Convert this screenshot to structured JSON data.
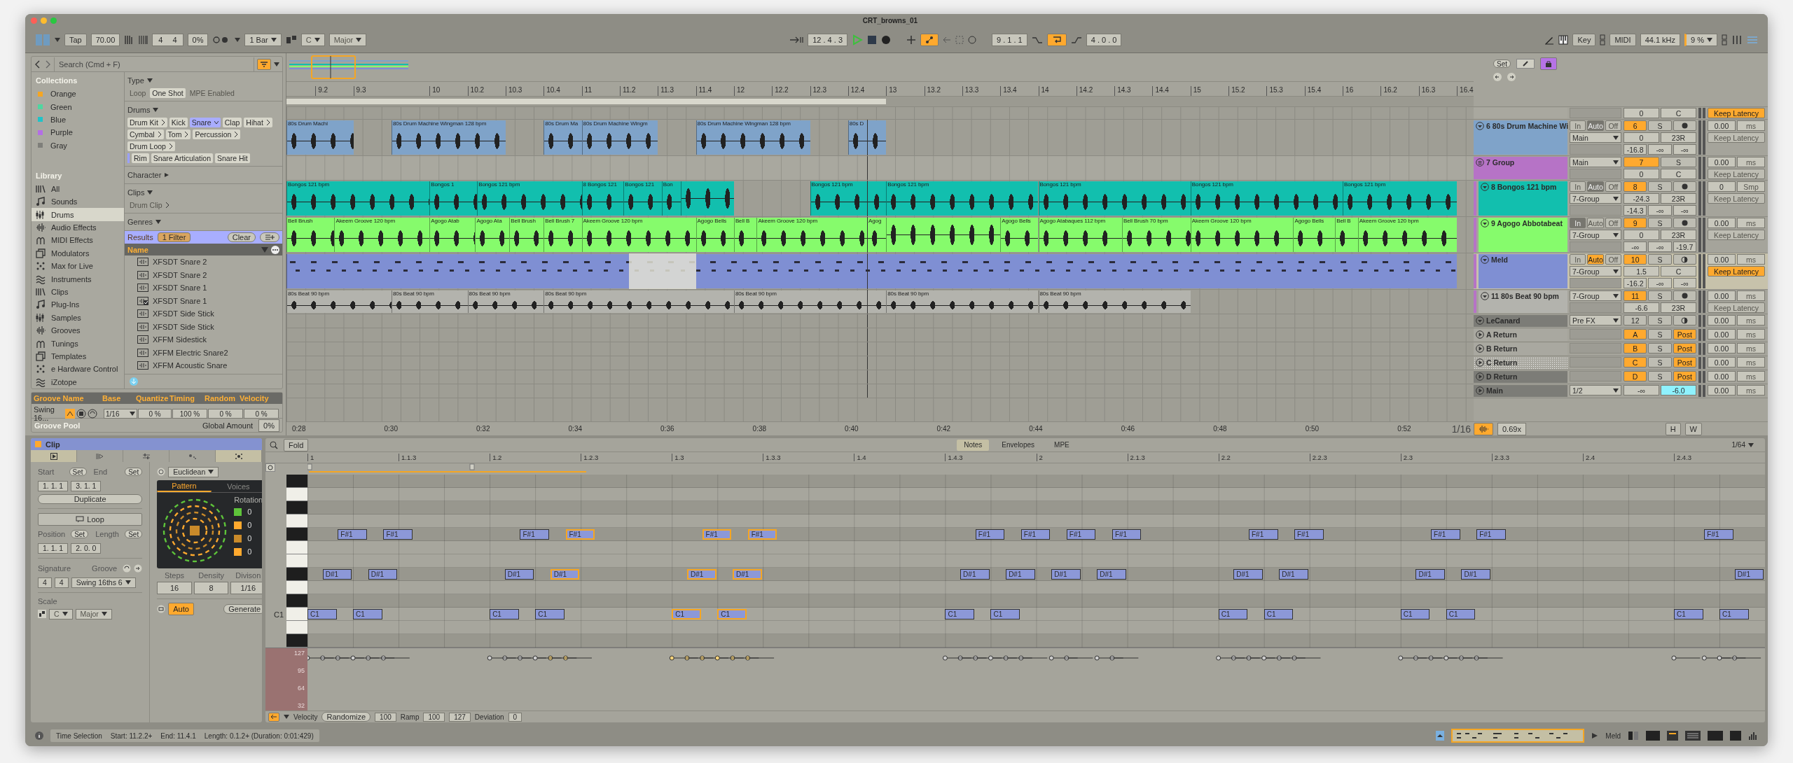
{
  "window": {
    "title": "CRT_browns_01"
  },
  "toolbar": {
    "tap": "Tap",
    "tempo": "70.00",
    "signature": [
      "4",
      "4"
    ],
    "groove_amount": "0%",
    "quantize": "1 Bar",
    "key": "C",
    "scale": "Major",
    "position": "12 . 4 . 3",
    "automation_arm": true,
    "loop_start": "9 . 1 . 1",
    "loop_on": true,
    "loop_length": "4 . 0 . 0",
    "key_map": "Key",
    "midi_map": "MIDI",
    "sample_rate": "44.1 kHz",
    "cpu": "9 %"
  },
  "browser": {
    "search": {
      "placeholder": "Search (Cmd + F)"
    },
    "collections": {
      "title": "Collections",
      "items": [
        {
          "label": "Orange",
          "color": "#f5a623"
        },
        {
          "label": "Green",
          "color": "#4fd6a0"
        },
        {
          "label": "Blue",
          "color": "#1fc3c8"
        },
        {
          "label": "Purple",
          "color": "#b46ee6"
        },
        {
          "label": "Gray",
          "color": "#7f7f7a"
        }
      ]
    },
    "library": {
      "title": "Library",
      "items": [
        {
          "label": "All",
          "selected": false
        },
        {
          "label": "Sounds",
          "selected": false
        },
        {
          "label": "Drums",
          "selected": true
        },
        {
          "label": "Audio Effects",
          "selected": false
        },
        {
          "label": "MIDI Effects",
          "selected": false
        },
        {
          "label": "Modulators",
          "selected": false
        },
        {
          "label": "Max for Live",
          "selected": false
        },
        {
          "label": "Instruments",
          "selected": false
        },
        {
          "label": "Clips",
          "selected": false
        },
        {
          "label": "Plug-Ins",
          "selected": false
        },
        {
          "label": "Samples",
          "selected": false
        },
        {
          "label": "Grooves",
          "selected": false
        },
        {
          "label": "Tunings",
          "selected": false
        },
        {
          "label": "Templates",
          "selected": false
        },
        {
          "label": "e Hardware Control",
          "selected": false
        },
        {
          "label": "iZotope",
          "selected": false
        }
      ]
    },
    "filters": [
      {
        "title": "Type",
        "kind": "toggles",
        "expanded": true,
        "chips": [
          {
            "label": "Loop",
            "selected": false
          },
          {
            "label": "One Shot",
            "selected": true
          },
          {
            "label": "MPE Enabled",
            "selected": false
          }
        ]
      },
      {
        "title": "Drums",
        "kind": "tags",
        "expanded": true,
        "chips": [
          {
            "label": "Drum Kit",
            "selected": false,
            "more": true
          },
          {
            "label": "Kick",
            "selected": false,
            "more": false
          },
          {
            "label": "Snare",
            "selected": true,
            "more": true
          },
          {
            "label": "Clap",
            "selected": false,
            "more": false
          },
          {
            "label": "Hihat",
            "selected": false,
            "more": true
          },
          {
            "label": "Cymbal",
            "selected": false,
            "more": true
          },
          {
            "label": "Tom",
            "selected": false,
            "more": true
          },
          {
            "label": "Percussion",
            "selected": false,
            "more": true
          },
          {
            "label": "Drum Loop",
            "selected": false,
            "more": true
          }
        ],
        "subchips": [
          {
            "label": "Rim"
          },
          {
            "label": "Snare Articulation"
          },
          {
            "label": "Snare Hit"
          }
        ]
      },
      {
        "title": "Character",
        "expanded": false
      },
      {
        "title": "Clips",
        "kind": "tags",
        "expanded": true,
        "chips": [
          {
            "label": "Drum Clip",
            "selected": false,
            "more": true,
            "disabled": true
          }
        ]
      },
      {
        "title": "Genres",
        "expanded": true
      }
    ],
    "results": {
      "title": "Results",
      "filter_count": "1 Filter",
      "clear": "Clear",
      "column": "Name",
      "items": [
        {
          "label": "XFSDT Snare 2",
          "kind": "sample"
        },
        {
          "label": "XFSDT Snare 2",
          "kind": "sample"
        },
        {
          "label": "XFSDT Snare 1",
          "kind": "sample"
        },
        {
          "label": "XFSDT Snare 1",
          "kind": "checked"
        },
        {
          "label": "XFSDT Side Stick",
          "kind": "sample"
        },
        {
          "label": "XFSDT Side Stick",
          "kind": "sample"
        },
        {
          "label": "XFFM Sidestick",
          "kind": "sample"
        },
        {
          "label": "XFFM Electric Snare2",
          "kind": "sample"
        },
        {
          "label": "XFFM Acoustic Snare",
          "kind": "sample"
        }
      ]
    }
  },
  "groove": {
    "columns": [
      "Groove Name",
      "Base",
      "Quantize",
      "Timing",
      "Random",
      "Velocity"
    ],
    "row": {
      "name": "Swing 16...",
      "base": "1/16",
      "quantize": "0 %",
      "timing": "100 %",
      "random": "0 %",
      "velocity": "0 %"
    },
    "pool_title": "Groove Pool",
    "global_label": "Global Amount",
    "global_value": "0%"
  },
  "arrangement": {
    "ruler": [
      "9.2",
      "9.3",
      "10",
      "10.2",
      "10.3",
      "10.4",
      "11",
      "11.2",
      "11.3",
      "11.4",
      "12",
      "12.2",
      "12.3",
      "12.4",
      "13",
      "13.2",
      "13.3",
      "13.4",
      "14",
      "14.2",
      "14.3",
      "14.4",
      "15",
      "15.2",
      "15.3",
      "15.4",
      "16",
      "16.2",
      "16.3",
      "16.4"
    ],
    "time_ruler": [
      "0:28",
      "0:30",
      "0:32",
      "0:34",
      "0:36",
      "0:38",
      "0:40",
      "0:42",
      "0:44",
      "0:46",
      "0:48",
      "0:50",
      "0:52"
    ],
    "grid": "1/16",
    "mixer": {
      "set": "Set",
      "lock_on": true,
      "waveform_on": true,
      "zoom": "0.69x",
      "h": "H",
      "w": "W"
    },
    "tracks": [
      {
        "kind": "top",
        "volume": "0",
        "pan": "C",
        "latency": {
          "label": "Keep Latency",
          "on": true
        }
      },
      {
        "kind": "audio",
        "name": "6 80s Drum Machine Wi",
        "color": "#7fa3c9",
        "selected": false,
        "expanded": true,
        "monitor": [
          {
            "label": "In",
            "selected": false
          },
          {
            "label": "Auto",
            "selected": true
          },
          {
            "label": "Off",
            "selected": false
          }
        ],
        "route": "Main",
        "number": "6",
        "number_on": true,
        "solo": "S",
        "third": {
          "kind": "arm"
        },
        "volume": "0",
        "pan": "23R",
        "sends": [
          "-16.8",
          "-∞",
          "-∞"
        ],
        "delay": "0.00",
        "delay_unit": "ms",
        "latency": {
          "label": "Keep Latency",
          "on": false
        },
        "clips": [
          {
            "kind": "audio",
            "label": "80s Drum Machi"
          },
          {
            "kind": "audio",
            "label": "80s Drum Machine Wingman 128 bpm"
          },
          {
            "kind": "audio",
            "label": "80s Drum Ma"
          },
          {
            "kind": "audio",
            "label": "80s Drum Machine Wingm"
          },
          {
            "kind": "audio",
            "label": "80s Drum Machine Wingman 128 bpm"
          },
          {
            "kind": "audio",
            "label": "80s D"
          }
        ]
      },
      {
        "kind": "group",
        "name": "7 Group",
        "color": "#b673c6",
        "selected": false,
        "expanded": true,
        "route": "Main",
        "number": "7",
        "number_on": true,
        "solo": "S",
        "volume": "0",
        "pan": "C",
        "delay": "0.00",
        "delay_unit": "ms",
        "latency": {
          "label": "Keep Latency",
          "on": false
        },
        "children": [
          {
            "kind": "audio",
            "name": "8 Bongos 121 bpm",
            "color": "#12bfae",
            "selected": false,
            "expanded": true,
            "monitor": [
              {
                "label": "In",
                "selected": false
              },
              {
                "label": "Auto",
                "selected": true
              },
              {
                "label": "Off",
                "selected": false
              }
            ],
            "route": "7-Group",
            "number": "8",
            "number_on": true,
            "solo": "S",
            "third": {
              "kind": "arm"
            },
            "volume": "-24.3",
            "pan": "23R",
            "sends": [
              "-14.3",
              "-∞",
              "-∞"
            ],
            "delay": "0",
            "delay_unit": "Smp",
            "latency": {
              "label": "Keep Latency",
              "on": false
            },
            "clips": [
              {
                "kind": "audio",
                "label": "Bongos 121 bpm"
              },
              {
                "kind": "audio",
                "label": "Bongos 1"
              },
              {
                "kind": "audio",
                "label": "Bongos 121 bpm"
              },
              {
                "kind": "audio",
                "label": "8 Bongos 121"
              },
              {
                "kind": "audio",
                "label": "Bongos 121"
              },
              {
                "kind": "audio",
                "label": "Bon"
              },
              {
                "kind": "audio"
              },
              {
                "kind": "audio",
                "label": "Bongos 121 bpm"
              },
              {
                "kind": "audio",
                "label": "Bongos 121 bpm"
              },
              {
                "kind": "audio",
                "label": "Bongos 121 bpm"
              },
              {
                "kind": "audio",
                "label": "Bongos 121 bpm"
              },
              {
                "kind": "audio",
                "label": "Bongos 121 bpm"
              }
            ]
          },
          {
            "kind": "audio",
            "name": "9 Agogo Abbotabeat",
            "color": "#86fb6c",
            "selected": false,
            "expanded": true,
            "monitor": [
              {
                "label": "In",
                "selected": true
              },
              {
                "label": "Auto",
                "selected": false
              },
              {
                "label": "Off",
                "selected": false
              }
            ],
            "route": "7-Group",
            "number": "9",
            "number_on": true,
            "solo": "S",
            "third": {
              "kind": "arm"
            },
            "volume": "0",
            "pan": "23R",
            "sends": [
              "-∞",
              "-∞",
              "-19.7"
            ],
            "delay": "0.00",
            "delay_unit": "ms",
            "latency": {
              "label": "Keep Latency",
              "on": false
            },
            "clips": [
              {
                "kind": "audio",
                "label": "Bell Brush"
              },
              {
                "kind": "audio",
                "label": "Akeem Groove 120 bpm"
              },
              {
                "kind": "audio",
                "label": "Agogo Atab"
              },
              {
                "kind": "audio",
                "label": "Agogo Ata"
              },
              {
                "kind": "audio",
                "label": "Bell Brush"
              },
              {
                "kind": "audio",
                "label": "Bell Brush 7"
              },
              {
                "kind": "audio",
                "label": "Akeem Groove 120 bpm"
              },
              {
                "kind": "audio",
                "label": "Agogo Bells"
              },
              {
                "kind": "audio",
                "label": "Bell B"
              },
              {
                "kind": "audio",
                "label": "Akeem Groove 120 bpm"
              },
              {
                "kind": "audio",
                "label": "Agog"
              },
              {
                "kind": "audio"
              },
              {
                "kind": "audio",
                "label": "Agogo Bells"
              },
              {
                "kind": "audio",
                "label": "Agogo Atabaques 112 bpm"
              },
              {
                "kind": "audio",
                "label": "Bell Brush 70 bpm"
              },
              {
                "kind": "audio",
                "label": "Akeem Groove 120 bpm"
              },
              {
                "kind": "audio",
                "label": "Agogo Bells"
              },
              {
                "kind": "audio",
                "label": "Bell B"
              },
              {
                "kind": "audio",
                "label": "Akeem Groove 120 bpm"
              }
            ]
          },
          {
            "kind": "midi",
            "name": "Meld",
            "color": "#7f8fd3",
            "selected": true,
            "expanded": true,
            "monitor": [
              {
                "label": "In",
                "selected": false
              },
              {
                "label": "Auto",
                "selected": true
              },
              {
                "label": "Off",
                "selected": false
              }
            ],
            "route": "7-Group",
            "number": "10",
            "number_on": true,
            "solo": "S",
            "third": {
              "kind": "input"
            },
            "volume": "1.5",
            "pan": "C",
            "sends": [
              "-16.2",
              "-∞",
              "-∞"
            ],
            "delay": "0.00",
            "delay_unit": "ms",
            "latency": {
              "label": "Keep Latency",
              "on": true
            },
            "clips": [
              {
                "kind": "midi"
              }
            ]
          },
          {
            "kind": "audio",
            "name": "11 80s Beat 90 bpm",
            "color": "#b3b3ad",
            "selected": false,
            "expanded": true,
            "route": "7-Group",
            "number": "11",
            "number_on": true,
            "solo": "S",
            "third": {
              "kind": "arm"
            },
            "volume": "-6.6",
            "pan": "23R",
            "delay": "0.00",
            "delay_unit": "ms",
            "latency": {
              "label": "Keep Latency",
              "on": false
            },
            "clips": [
              {
                "kind": "audio",
                "label": "80s Beat 90 bpm"
              },
              {
                "kind": "audio",
                "label": "80s Beat 90 bpm"
              },
              {
                "kind": "audio",
                "label": "80s Beat 90 bpm"
              },
              {
                "kind": "audio",
                "label": "80s Beat 90 bpm"
              },
              {
                "kind": "audio",
                "label": "80s Beat 90 bpm"
              },
              {
                "kind": "audio",
                "label": "80s Beat 90 bpm"
              },
              {
                "kind": "audio",
                "label": "80s Beat 90 bpm"
              }
            ]
          }
        ]
      },
      {
        "kind": "collapsed",
        "name": "LeCanard",
        "color": "#7c7c77",
        "selected": false,
        "expanded": true,
        "route": "Pre FX",
        "number": "12",
        "number_on": false,
        "solo": "S",
        "third": {
          "kind": "input"
        },
        "delay": "0.00",
        "delay_unit": "ms"
      },
      {
        "kind": "return",
        "name": "A Return",
        "color": "#a9a8a0",
        "selected": false,
        "expanded": false,
        "number": "A",
        "number_on": true,
        "solo": "S",
        "third": {
          "kind": "label",
          "label": "Post",
          "on": true
        },
        "delay": "0.00",
        "delay_unit": "ms"
      },
      {
        "kind": "return",
        "name": "B Return",
        "color": "#a9a8a0",
        "selected": false,
        "expanded": false,
        "number": "B",
        "number_on": true,
        "solo": "S",
        "third": {
          "kind": "label",
          "label": "Post",
          "on": true
        },
        "delay": "0.00",
        "delay_unit": "ms"
      },
      {
        "kind": "return",
        "name": "C Return",
        "color": "#a9a8a0",
        "selected": true,
        "expanded": false,
        "number": "C",
        "number_on": true,
        "solo": "S",
        "third": {
          "kind": "label",
          "label": "Post",
          "on": true
        },
        "delay": "0.00",
        "delay_unit": "ms"
      },
      {
        "kind": "return",
        "name": "D Return",
        "color": "#7c7c77",
        "selected": false,
        "expanded": false,
        "number": "D",
        "number_on": true,
        "solo": "S",
        "third": {
          "kind": "label",
          "label": "Post",
          "on": true
        },
        "delay": "0.00",
        "delay_unit": "ms"
      },
      {
        "kind": "main",
        "name": "Main",
        "color": "#7c7c77",
        "selected": false,
        "expanded": false,
        "route": "1/2",
        "peak": "-∞",
        "volume": "-6.0",
        "volume_focused": true,
        "delay": "0.00",
        "delay_unit": "ms"
      }
    ]
  },
  "clip_view": {
    "title": "Clip",
    "left_tabs": [
      {
        "selected": true
      },
      {
        "selected": false
      }
    ],
    "right_tabs": [
      {
        "selected": false
      },
      {
        "selected": false
      },
      {
        "selected": true
      }
    ],
    "start": {
      "label": "Start",
      "set": "Set",
      "value": "1. 1. 1"
    },
    "end": {
      "label": "End",
      "set": "Set",
      "value": "3. 1. 1"
    },
    "duplicate": "Duplicate",
    "loop": "Loop",
    "position": {
      "label": "Position",
      "set": "Set",
      "value": "1. 1. 1"
    },
    "length": {
      "label": "Length",
      "set": "Set",
      "value": "2. 0. 0"
    },
    "signature": {
      "label": "Signature",
      "values": [
        "4",
        "4"
      ]
    },
    "groove": {
      "label": "Groove",
      "value": "Swing 16ths 6"
    },
    "scale": {
      "label": "Scale",
      "root": "C",
      "name": "Major"
    },
    "generator": {
      "name": "Euclidean",
      "tabs": [
        {
          "label": "Pattern",
          "selected": true
        },
        {
          "label": "Voices",
          "selected": false
        }
      ],
      "rotation_label": "Rotation",
      "voices": [
        {
          "color": "#5ec43a",
          "rotation": "0"
        },
        {
          "color": "#ffa92e",
          "rotation": "0"
        },
        {
          "color": "#c98a2a",
          "rotation": "0"
        },
        {
          "color": "#ffa92e",
          "rotation": "0"
        }
      ],
      "params": [
        {
          "label": "Steps",
          "value": "16"
        },
        {
          "label": "Density",
          "value": "8"
        },
        {
          "label": "Divison",
          "value": "1/16"
        }
      ],
      "auto": "Auto",
      "auto_on": true,
      "generate": "Generate"
    }
  },
  "note_editor": {
    "fold": "Fold",
    "tabs": [
      {
        "label": "Notes",
        "selected": true
      },
      {
        "label": "Envelopes",
        "selected": false
      },
      {
        "label": "MPE",
        "selected": false
      }
    ],
    "grid": "1/64",
    "ruler": [
      "1",
      "1.1.3",
      "1.2",
      "1.2.3",
      "1.3",
      "1.3.3",
      "1.4",
      "1.4.3",
      "2",
      "2.1.3",
      "2.2",
      "2.2.3",
      "2.3",
      "2.3.3",
      "2.4",
      "2.4.3"
    ],
    "key_rows": [
      {
        "kind": "black"
      },
      {
        "kind": "white"
      },
      {
        "kind": "black"
      },
      {
        "kind": "white"
      },
      {
        "kind": "black",
        "steps": [
          {
            "kind": "note",
            "label": "F#1",
            "selected": false
          },
          {
            "kind": "note",
            "label": "F#1",
            "selected": false
          },
          {
            "kind": "rest"
          },
          {
            "kind": "rest"
          },
          {
            "kind": "note",
            "label": "F#1",
            "selected": false
          },
          {
            "kind": "note",
            "label": "F#1",
            "selected": true
          },
          {
            "kind": "rest"
          },
          {
            "kind": "rest"
          },
          {
            "kind": "note",
            "label": "F#1",
            "selected": true
          },
          {
            "kind": "note",
            "label": "F#1",
            "selected": true
          },
          {
            "kind": "rest"
          },
          {
            "kind": "rest"
          },
          {
            "kind": "rest"
          },
          {
            "kind": "rest"
          },
          {
            "kind": "note",
            "label": "F#1",
            "selected": false
          },
          {
            "kind": "note",
            "label": "F#1",
            "selected": false
          },
          {
            "kind": "note",
            "label": "F#1",
            "selected": false
          },
          {
            "kind": "note",
            "label": "F#1",
            "selected": false
          },
          {
            "kind": "rest"
          },
          {
            "kind": "rest"
          },
          {
            "kind": "note",
            "label": "F#1",
            "selected": false
          },
          {
            "kind": "note",
            "label": "F#1",
            "selected": false
          },
          {
            "kind": "rest"
          },
          {
            "kind": "rest"
          },
          {
            "kind": "note",
            "label": "F#1",
            "selected": false
          },
          {
            "kind": "note",
            "label": "F#1",
            "selected": false
          },
          {
            "kind": "rest"
          },
          {
            "kind": "rest"
          },
          {
            "kind": "rest"
          },
          {
            "kind": "rest"
          },
          {
            "kind": "note",
            "label": "F#1",
            "selected": false
          }
        ]
      },
      {
        "kind": "white"
      },
      {
        "kind": "white"
      },
      {
        "kind": "black",
        "steps": [
          {
            "kind": "note",
            "label": "D#1",
            "selected": false
          },
          {
            "kind": "note",
            "label": "D#1",
            "selected": false
          },
          {
            "kind": "rest"
          },
          {
            "kind": "rest"
          },
          {
            "kind": "note",
            "label": "D#1",
            "selected": false
          },
          {
            "kind": "note",
            "label": "D#1",
            "selected": true
          },
          {
            "kind": "rest"
          },
          {
            "kind": "rest"
          },
          {
            "kind": "note",
            "label": "D#1",
            "selected": true
          },
          {
            "kind": "note",
            "label": "D#1",
            "selected": true
          },
          {
            "kind": "rest"
          },
          {
            "kind": "rest"
          },
          {
            "kind": "rest"
          },
          {
            "kind": "rest"
          },
          {
            "kind": "note",
            "label": "D#1",
            "selected": false
          },
          {
            "kind": "note",
            "label": "D#1",
            "selected": false
          },
          {
            "kind": "note",
            "label": "D#1",
            "selected": false
          },
          {
            "kind": "note",
            "label": "D#1",
            "selected": false
          },
          {
            "kind": "rest"
          },
          {
            "kind": "rest"
          },
          {
            "kind": "note",
            "label": "D#1",
            "selected": false
          },
          {
            "kind": "note",
            "label": "D#1",
            "selected": false
          },
          {
            "kind": "rest"
          },
          {
            "kind": "rest"
          },
          {
            "kind": "note",
            "label": "D#1",
            "selected": false
          },
          {
            "kind": "note",
            "label": "D#1",
            "selected": false
          },
          {
            "kind": "rest"
          },
          {
            "kind": "rest"
          },
          {
            "kind": "rest"
          },
          {
            "kind": "rest"
          },
          {
            "kind": "rest"
          },
          {
            "kind": "note",
            "label": "D#1",
            "selected": false
          }
        ]
      },
      {
        "kind": "white"
      },
      {
        "kind": "black"
      },
      {
        "kind": "white",
        "key_label": "C1",
        "steps": [
          {
            "kind": "note",
            "label": "C1",
            "selected": false
          },
          {
            "kind": "note",
            "label": "C1",
            "selected": false
          },
          {
            "kind": "rest"
          },
          {
            "kind": "rest"
          },
          {
            "kind": "note",
            "label": "C1",
            "selected": false
          },
          {
            "kind": "note",
            "label": "C1",
            "selected": false
          },
          {
            "kind": "rest"
          },
          {
            "kind": "rest"
          },
          {
            "kind": "note",
            "label": "C1",
            "selected": true
          },
          {
            "kind": "note",
            "label": "C1",
            "selected": true
          },
          {
            "kind": "rest"
          },
          {
            "kind": "rest"
          },
          {
            "kind": "rest"
          },
          {
            "kind": "rest"
          },
          {
            "kind": "note",
            "label": "C1",
            "selected": false
          },
          {
            "kind": "note",
            "label": "C1",
            "selected": false
          },
          {
            "kind": "rest"
          },
          {
            "kind": "rest"
          },
          {
            "kind": "rest"
          },
          {
            "kind": "rest"
          },
          {
            "kind": "note",
            "label": "C1",
            "selected": false
          },
          {
            "kind": "note",
            "label": "C1",
            "selected": false
          },
          {
            "kind": "rest"
          },
          {
            "kind": "rest"
          },
          {
            "kind": "note",
            "label": "C1",
            "selected": false
          },
          {
            "kind": "note",
            "label": "C1",
            "selected": false
          },
          {
            "kind": "rest"
          },
          {
            "kind": "rest"
          },
          {
            "kind": "rest"
          },
          {
            "kind": "rest"
          },
          {
            "kind": "note",
            "label": "C1",
            "selected": false
          },
          {
            "kind": "note",
            "label": "C1",
            "selected": false
          }
        ]
      },
      {
        "kind": "white"
      },
      {
        "kind": "black"
      }
    ],
    "velocity_ticks": [
      "127",
      "95",
      "64",
      "32"
    ],
    "footer": {
      "velocity": "Velocity",
      "randomize": "Randomize",
      "randomize_value": "100",
      "ramp": "Ramp",
      "ramp_values": [
        "100",
        "127"
      ],
      "deviation": "Deviation",
      "deviation_value": "0"
    }
  },
  "status_bar": {
    "mode": "Time Selection",
    "fields": [
      "Start: 11.2.2+",
      "End: 11.4.1",
      "Length: 0.1.2+ (Duration: 0:01:429)"
    ],
    "track": "Meld"
  }
}
